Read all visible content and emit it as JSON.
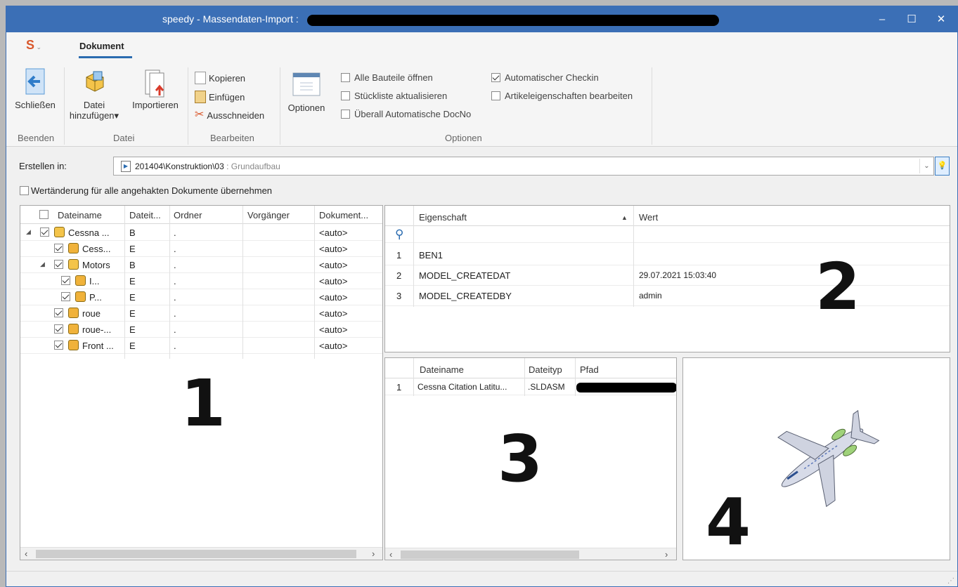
{
  "window": {
    "title": "speedy - Massendaten-Import :",
    "minimize": "‒",
    "maximize": "☐",
    "close": "✕"
  },
  "ribbon": {
    "app_menu": "S",
    "tab": "Dokument",
    "buttons": {
      "close": "Schließen",
      "add_file_line1": "Datei",
      "add_file_line2": "hinzufügen▾",
      "import": "Importieren",
      "copy": "Kopieren",
      "paste": "Einfügen",
      "cut": "Ausschneiden",
      "options": "Optionen"
    },
    "groups": {
      "end": "Beenden",
      "file": "Datei",
      "edit": "Bearbeiten",
      "options": "Optionen"
    },
    "options": {
      "open_all_parts": "Alle Bauteile öffnen",
      "update_bom": "Stückliste aktualisieren",
      "auto_docno": "Überall Automatische DocNo",
      "auto_checkin": "Automatischer Checkin",
      "edit_article_props": "Artikeleigenschaften bearbeiten"
    },
    "options_state": {
      "open_all_parts": false,
      "update_bom": false,
      "auto_docno": false,
      "auto_checkin": true,
      "edit_article_props": false
    }
  },
  "create_in": {
    "label": "Erstellen in:",
    "path": "201404\\Konstruktion\\03",
    "hint": ": Grundaufbau",
    "apply_label": "Wertänderung für alle angehakten Dokumente übernehmen"
  },
  "tree": {
    "columns": [
      "Dateiname",
      "Dateit...",
      "Ordner",
      "Vorgänger",
      "Dokument..."
    ],
    "rows": [
      {
        "name": "Cessna ...",
        "type": "B",
        "folder": ".",
        "prev": "",
        "doc": "<auto>"
      },
      {
        "name": "Cess...",
        "type": "E",
        "folder": ".",
        "prev": "",
        "doc": "<auto>"
      },
      {
        "name": "Motors",
        "type": "B",
        "folder": ".",
        "prev": "",
        "doc": "<auto>"
      },
      {
        "name": "I...",
        "type": "E",
        "folder": ".",
        "prev": "",
        "doc": "<auto>"
      },
      {
        "name": "P...",
        "type": "E",
        "folder": ".",
        "prev": "",
        "doc": "<auto>"
      },
      {
        "name": "roue",
        "type": "E",
        "folder": ".",
        "prev": "",
        "doc": "<auto>"
      },
      {
        "name": "roue-...",
        "type": "E",
        "folder": ".",
        "prev": "",
        "doc": "<auto>"
      },
      {
        "name": "Front ...",
        "type": "E",
        "folder": ".",
        "prev": "",
        "doc": "<auto>"
      }
    ],
    "big_label": "1"
  },
  "props": {
    "columns": [
      "Eigenschaft",
      "Wert"
    ],
    "rows": [
      {
        "n": "1",
        "prop": "BEN1",
        "val": ""
      },
      {
        "n": "2",
        "prop": "MODEL_CREATEDAT",
        "val": "29.07.2021 15:03:40"
      },
      {
        "n": "3",
        "prop": "MODEL_CREATEDBY",
        "val": "admin"
      }
    ],
    "big_label": "2"
  },
  "files": {
    "columns": [
      "Dateiname",
      "Dateityp",
      "Pfad"
    ],
    "rows": [
      {
        "n": "1",
        "name": "Cessna Citation Latitu...",
        "type": ".SLDASM"
      }
    ],
    "big_label": "3"
  },
  "preview": {
    "big_label": "4"
  },
  "colors": {
    "titlebar": "#3b6fb6",
    "accent": "#2b6cb0"
  }
}
